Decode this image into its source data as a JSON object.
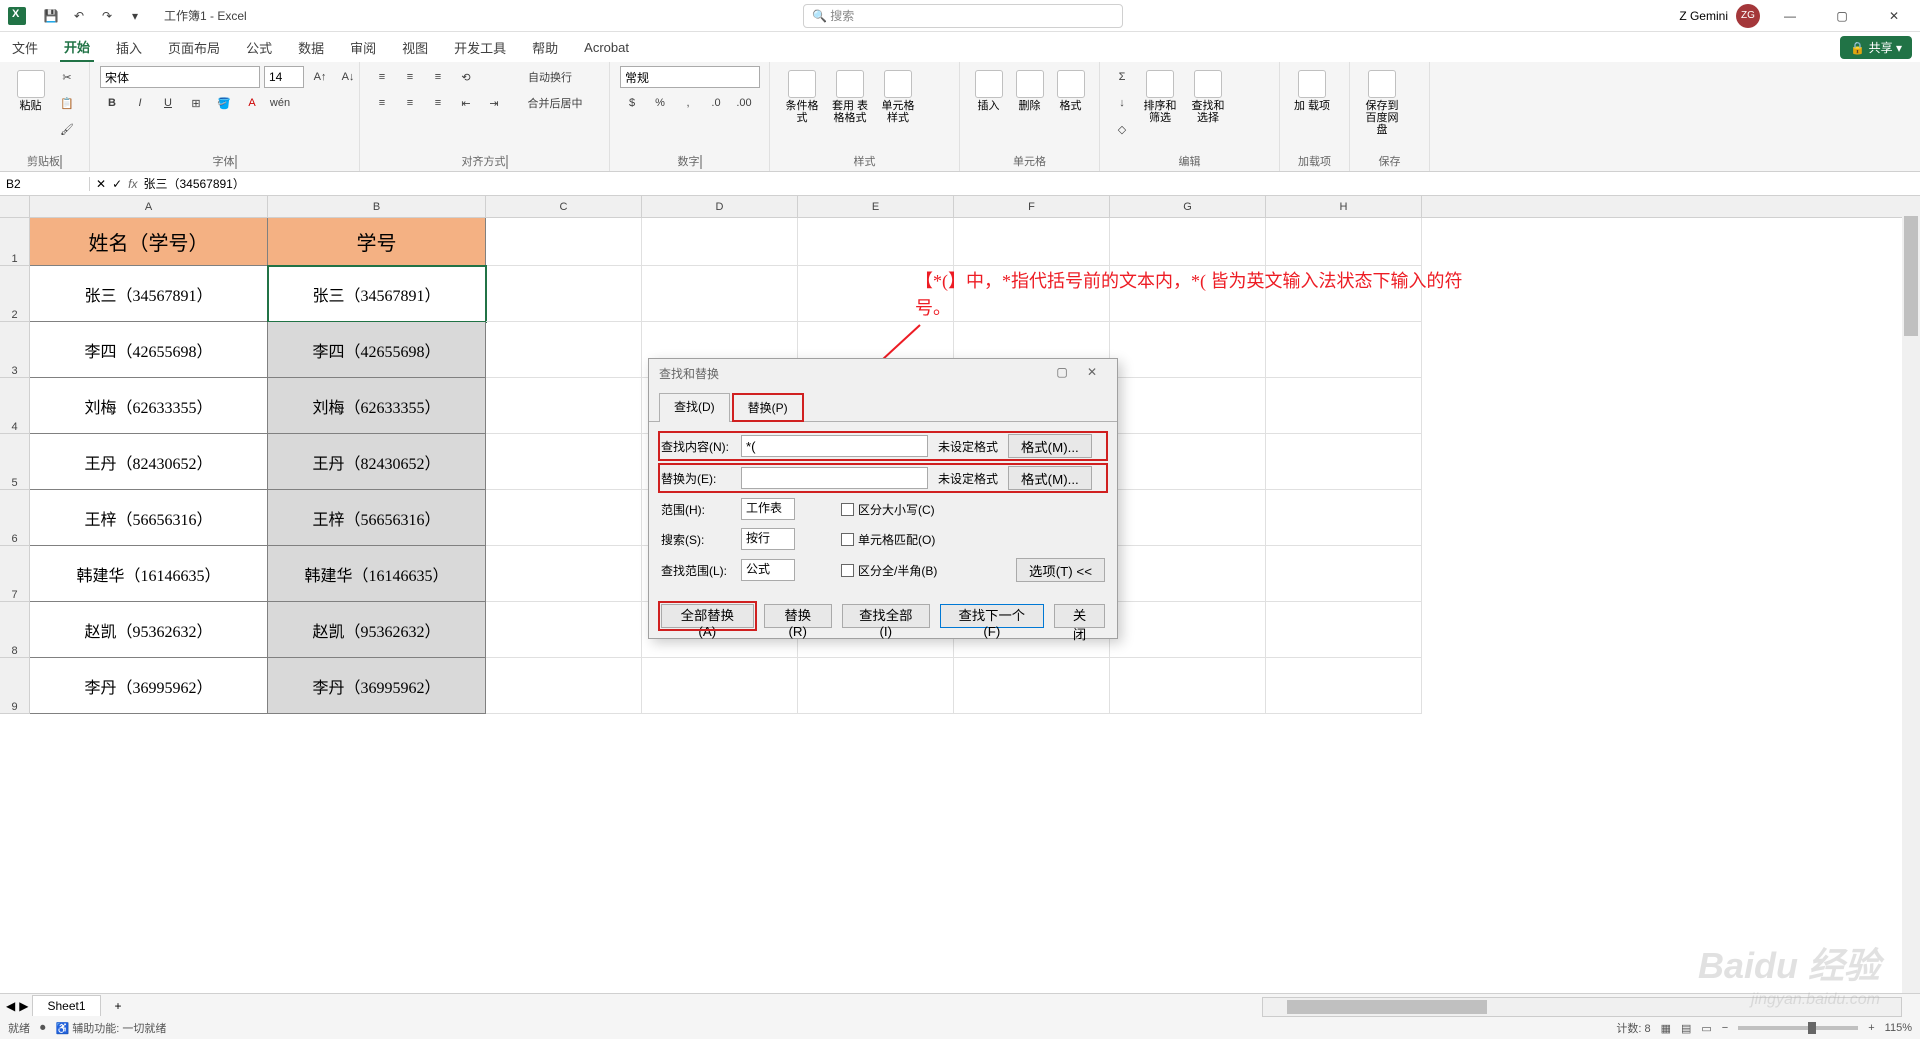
{
  "titlebar": {
    "title": "工作簿1 - Excel",
    "search_placeholder": "搜索",
    "user_name": "Z Gemini",
    "user_initials": "ZG"
  },
  "qat": {
    "save": "💾",
    "undo": "↶",
    "redo": "↷",
    "more": "▾"
  },
  "tabs": {
    "file": "文件",
    "home": "开始",
    "insert": "插入",
    "layout": "页面布局",
    "formulas": "公式",
    "data": "数据",
    "review": "审阅",
    "view": "视图",
    "dev": "开发工具",
    "help": "帮助",
    "acrobat": "Acrobat",
    "share": "共享"
  },
  "ribbon": {
    "clipboard": {
      "paste": "粘贴",
      "label": "剪贴板"
    },
    "font": {
      "name": "宋体",
      "size": "14",
      "label": "字体",
      "bold": "B",
      "italic": "I",
      "underline": "U"
    },
    "align": {
      "wrap": "自动换行",
      "merge": "合并后居中",
      "label": "对齐方式"
    },
    "number": {
      "format": "常规",
      "label": "数字"
    },
    "styles": {
      "cond": "条件格式",
      "table": "套用\n表格格式",
      "cell": "单元格样式",
      "label": "样式"
    },
    "cells": {
      "insert": "插入",
      "delete": "删除",
      "format": "格式",
      "label": "单元格"
    },
    "editing": {
      "sort": "排序和筛选",
      "find": "查找和选择",
      "label": "编辑"
    },
    "addins": {
      "add": "加\n载项",
      "label": "加载项"
    },
    "baidu": {
      "save": "保存到\n百度网盘",
      "label": "保存"
    }
  },
  "fbar": {
    "name": "B2",
    "formula": "张三（34567891）"
  },
  "cols": [
    "A",
    "B",
    "C",
    "D",
    "E",
    "F",
    "G",
    "H"
  ],
  "headerRow": {
    "A": "姓名（学号）",
    "B": "学号"
  },
  "dataRows": [
    {
      "A": "张三（34567891）",
      "B": "张三（34567891）"
    },
    {
      "A": "李四（42655698）",
      "B": "李四（42655698）"
    },
    {
      "A": "刘梅（62633355）",
      "B": "刘梅（62633355）"
    },
    {
      "A": "王丹（82430652）",
      "B": "王丹（82430652）"
    },
    {
      "A": "王梓（56656316）",
      "B": "王梓（56656316）"
    },
    {
      "A": "韩建华（16146635）",
      "B": "韩建华（16146635）"
    },
    {
      "A": "赵凯（95362632）",
      "B": "赵凯（95362632）"
    },
    {
      "A": "李丹（36995962）",
      "B": "李丹（36995962）"
    }
  ],
  "dialog": {
    "title": "查找和替换",
    "tab_find": "查找(D)",
    "tab_replace": "替换(P)",
    "find_label": "查找内容(N):",
    "find_value": "*(",
    "replace_label": "替换为(E):",
    "replace_value": "",
    "no_format": "未设定格式",
    "format_btn": "格式(M)...",
    "within_label": "范围(H):",
    "within_value": "工作表",
    "search_label": "搜索(S):",
    "search_value": "按行",
    "lookin_label": "查找范围(L):",
    "lookin_value": "公式",
    "match_case": "区分大小写(C)",
    "match_entire": "单元格匹配(O)",
    "match_width": "区分全/半角(B)",
    "options": "选项(T) <<",
    "replace_all": "全部替换(A)",
    "replace_btn": "替换(R)",
    "find_all": "查找全部(I)",
    "find_next": "查找下一个(F)",
    "close": "关闭"
  },
  "annotation": "【*(】中，*指代括号前的文本内，*( 皆为英文输入法状态下输入的符号。",
  "sheet": {
    "name": "Sheet1",
    "add": "+"
  },
  "status": {
    "ready": "就绪",
    "acc": "辅助功能: 一切就绪",
    "count_label": "计数",
    "count": "8",
    "zoom": "115%"
  },
  "watermark": "Baidu 经验",
  "watermark2": "jingyan.baidu.com"
}
